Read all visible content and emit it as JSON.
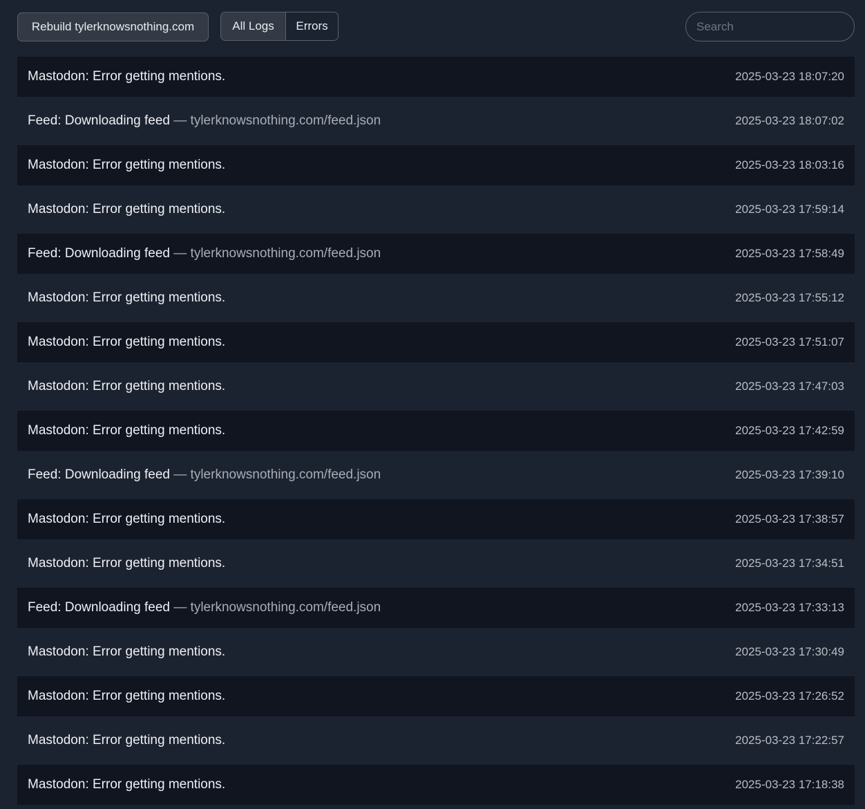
{
  "toolbar": {
    "rebuild_label": "Rebuild tylerknowsnothing.com",
    "filters": [
      {
        "label": "All Logs",
        "active": true
      },
      {
        "label": "Errors",
        "active": false
      }
    ],
    "search_placeholder": "Search",
    "search_value": ""
  },
  "logs": [
    {
      "message": "Mastodon: Error getting mentions.",
      "separator": "",
      "detail": "",
      "timestamp": "2025-03-23 18:07:20"
    },
    {
      "message": "Feed: Downloading feed",
      "separator": " — ",
      "detail": "tylerknowsnothing.com/feed.json",
      "timestamp": "2025-03-23 18:07:02"
    },
    {
      "message": "Mastodon: Error getting mentions.",
      "separator": "",
      "detail": "",
      "timestamp": "2025-03-23 18:03:16"
    },
    {
      "message": "Mastodon: Error getting mentions.",
      "separator": "",
      "detail": "",
      "timestamp": "2025-03-23 17:59:14"
    },
    {
      "message": "Feed: Downloading feed",
      "separator": " — ",
      "detail": "tylerknowsnothing.com/feed.json",
      "timestamp": "2025-03-23 17:58:49"
    },
    {
      "message": "Mastodon: Error getting mentions.",
      "separator": "",
      "detail": "",
      "timestamp": "2025-03-23 17:55:12"
    },
    {
      "message": "Mastodon: Error getting mentions.",
      "separator": "",
      "detail": "",
      "timestamp": "2025-03-23 17:51:07"
    },
    {
      "message": "Mastodon: Error getting mentions.",
      "separator": "",
      "detail": "",
      "timestamp": "2025-03-23 17:47:03"
    },
    {
      "message": "Mastodon: Error getting mentions.",
      "separator": "",
      "detail": "",
      "timestamp": "2025-03-23 17:42:59"
    },
    {
      "message": "Feed: Downloading feed",
      "separator": " — ",
      "detail": "tylerknowsnothing.com/feed.json",
      "timestamp": "2025-03-23 17:39:10"
    },
    {
      "message": "Mastodon: Error getting mentions.",
      "separator": "",
      "detail": "",
      "timestamp": "2025-03-23 17:38:57"
    },
    {
      "message": "Mastodon: Error getting mentions.",
      "separator": "",
      "detail": "",
      "timestamp": "2025-03-23 17:34:51"
    },
    {
      "message": "Feed: Downloading feed",
      "separator": " — ",
      "detail": "tylerknowsnothing.com/feed.json",
      "timestamp": "2025-03-23 17:33:13"
    },
    {
      "message": "Mastodon: Error getting mentions.",
      "separator": "",
      "detail": "",
      "timestamp": "2025-03-23 17:30:49"
    },
    {
      "message": "Mastodon: Error getting mentions.",
      "separator": "",
      "detail": "",
      "timestamp": "2025-03-23 17:26:52"
    },
    {
      "message": "Mastodon: Error getting mentions.",
      "separator": "",
      "detail": "",
      "timestamp": "2025-03-23 17:22:57"
    },
    {
      "message": "Mastodon: Error getting mentions.",
      "separator": "",
      "detail": "",
      "timestamp": "2025-03-23 17:18:38"
    }
  ]
}
